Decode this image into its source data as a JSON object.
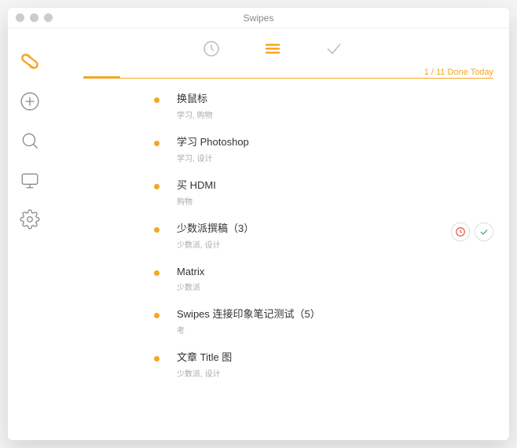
{
  "window": {
    "title": "Swipes"
  },
  "progress": {
    "label": "1 / 11 Done Today",
    "percent": 9
  },
  "tasks": [
    {
      "title": "换鼠标",
      "tags": "学习, 购物"
    },
    {
      "title": "学习 Photoshop",
      "tags": "学习, 设计"
    },
    {
      "title": "买 HDMI",
      "tags": "购物"
    },
    {
      "title": "少数派撰稿（3）",
      "tags": "少数派, 设计",
      "selected": true
    },
    {
      "title": "Matrix",
      "tags": "少数派"
    },
    {
      "title": "Swipes 连接印象笔记测试（5）",
      "tags": "考"
    },
    {
      "title": "文章 Title 图",
      "tags": "少数派, 设计"
    }
  ],
  "icons": {
    "logo": "swipes-logo",
    "add": "plus-circle",
    "search": "magnifier",
    "desktop": "monitor",
    "settings": "gear",
    "tab_schedule": "clock",
    "tab_now": "lines",
    "tab_done": "check",
    "action_snooze": "clock",
    "action_done": "check"
  }
}
